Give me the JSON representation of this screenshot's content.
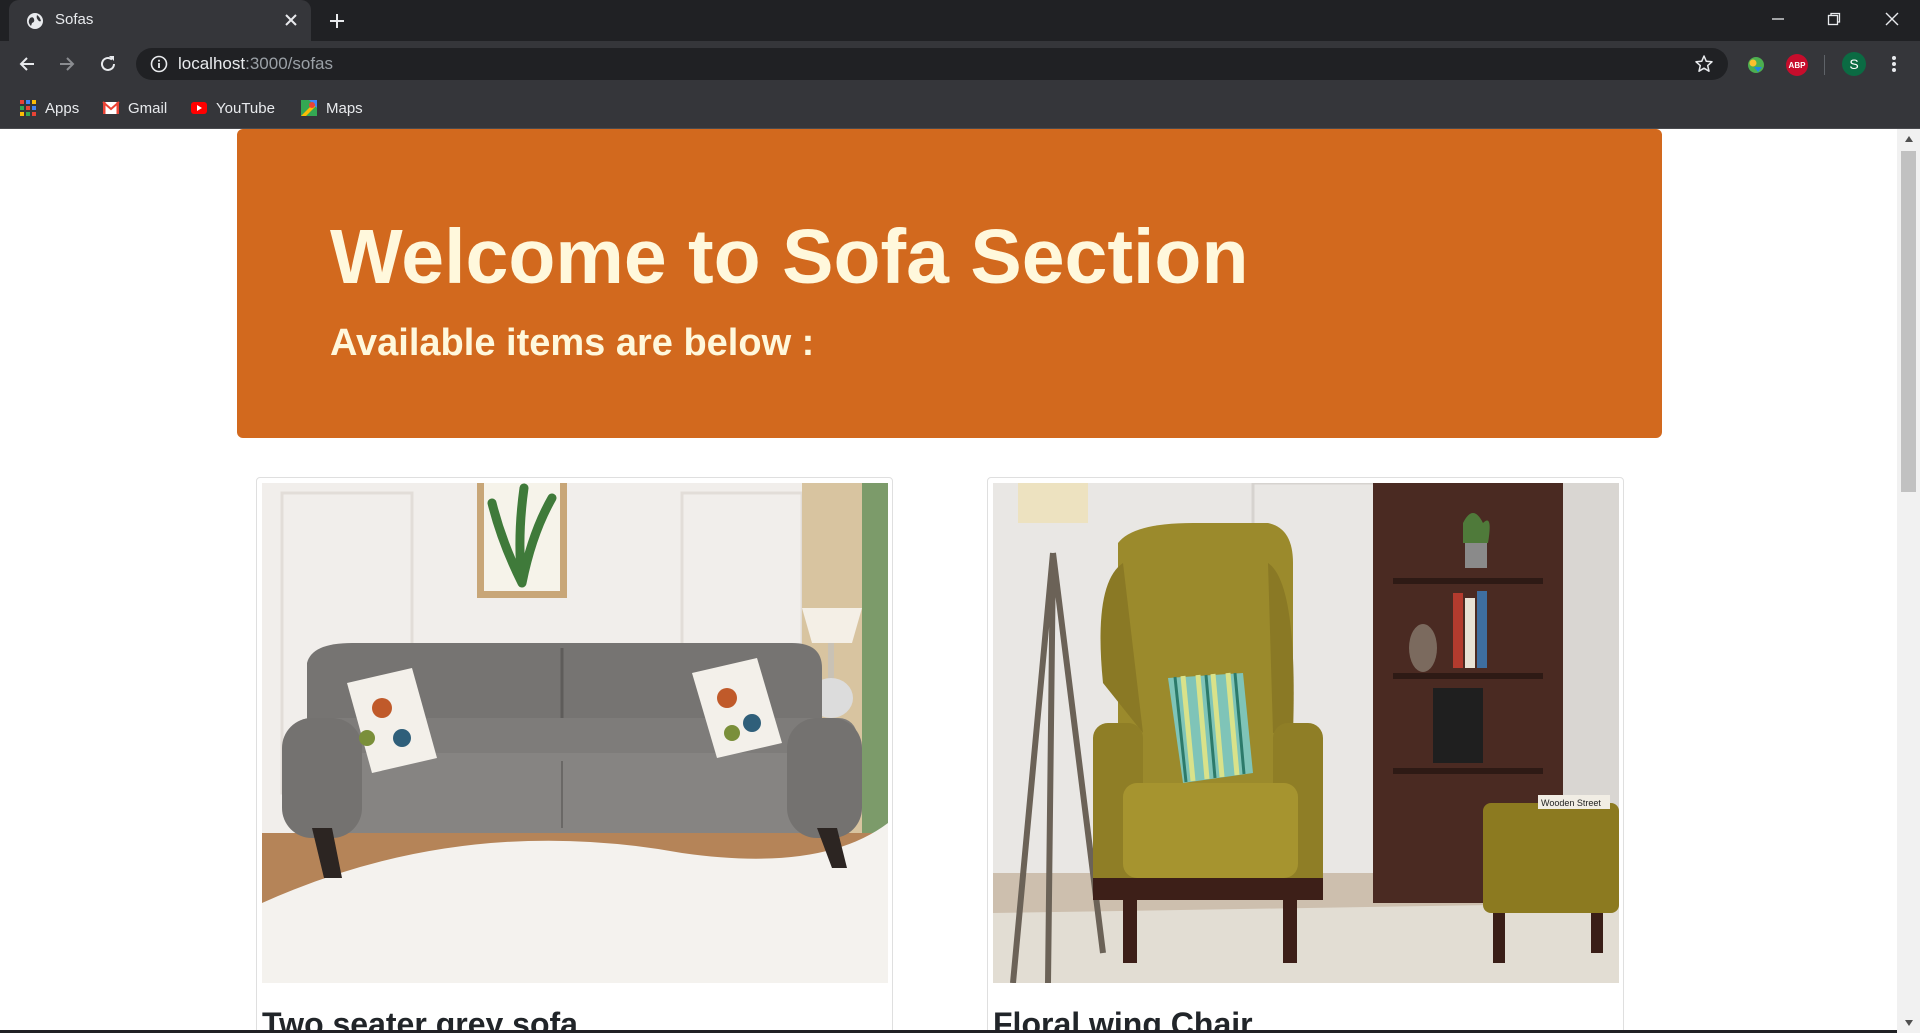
{
  "browser": {
    "tab": {
      "title": "Sofas"
    },
    "address": {
      "host": "localhost",
      "path": ":3000/sofas"
    },
    "profile_initial": "S",
    "extension_abp": "ABP",
    "bookmarks": [
      {
        "label": "Apps",
        "icon": "apps-grid-icon"
      },
      {
        "label": "Gmail",
        "icon": "gmail-icon"
      },
      {
        "label": "YouTube",
        "icon": "youtube-icon"
      },
      {
        "label": "Maps",
        "icon": "maps-icon"
      }
    ]
  },
  "page": {
    "heading": "Welcome to Sofa Section",
    "subheading": "Available items are below :",
    "colors": {
      "banner": "#d2691e",
      "banner_text": "#fff8dc"
    },
    "products": [
      {
        "title": "Two seater grey sofa",
        "image": "grey two-seater sofa with floral cushions"
      },
      {
        "title": "Floral wing Chair",
        "image": "olive green velvet wing chair with striped cushion"
      }
    ],
    "image_labels": {
      "wooden_street": "Wooden Street"
    }
  }
}
